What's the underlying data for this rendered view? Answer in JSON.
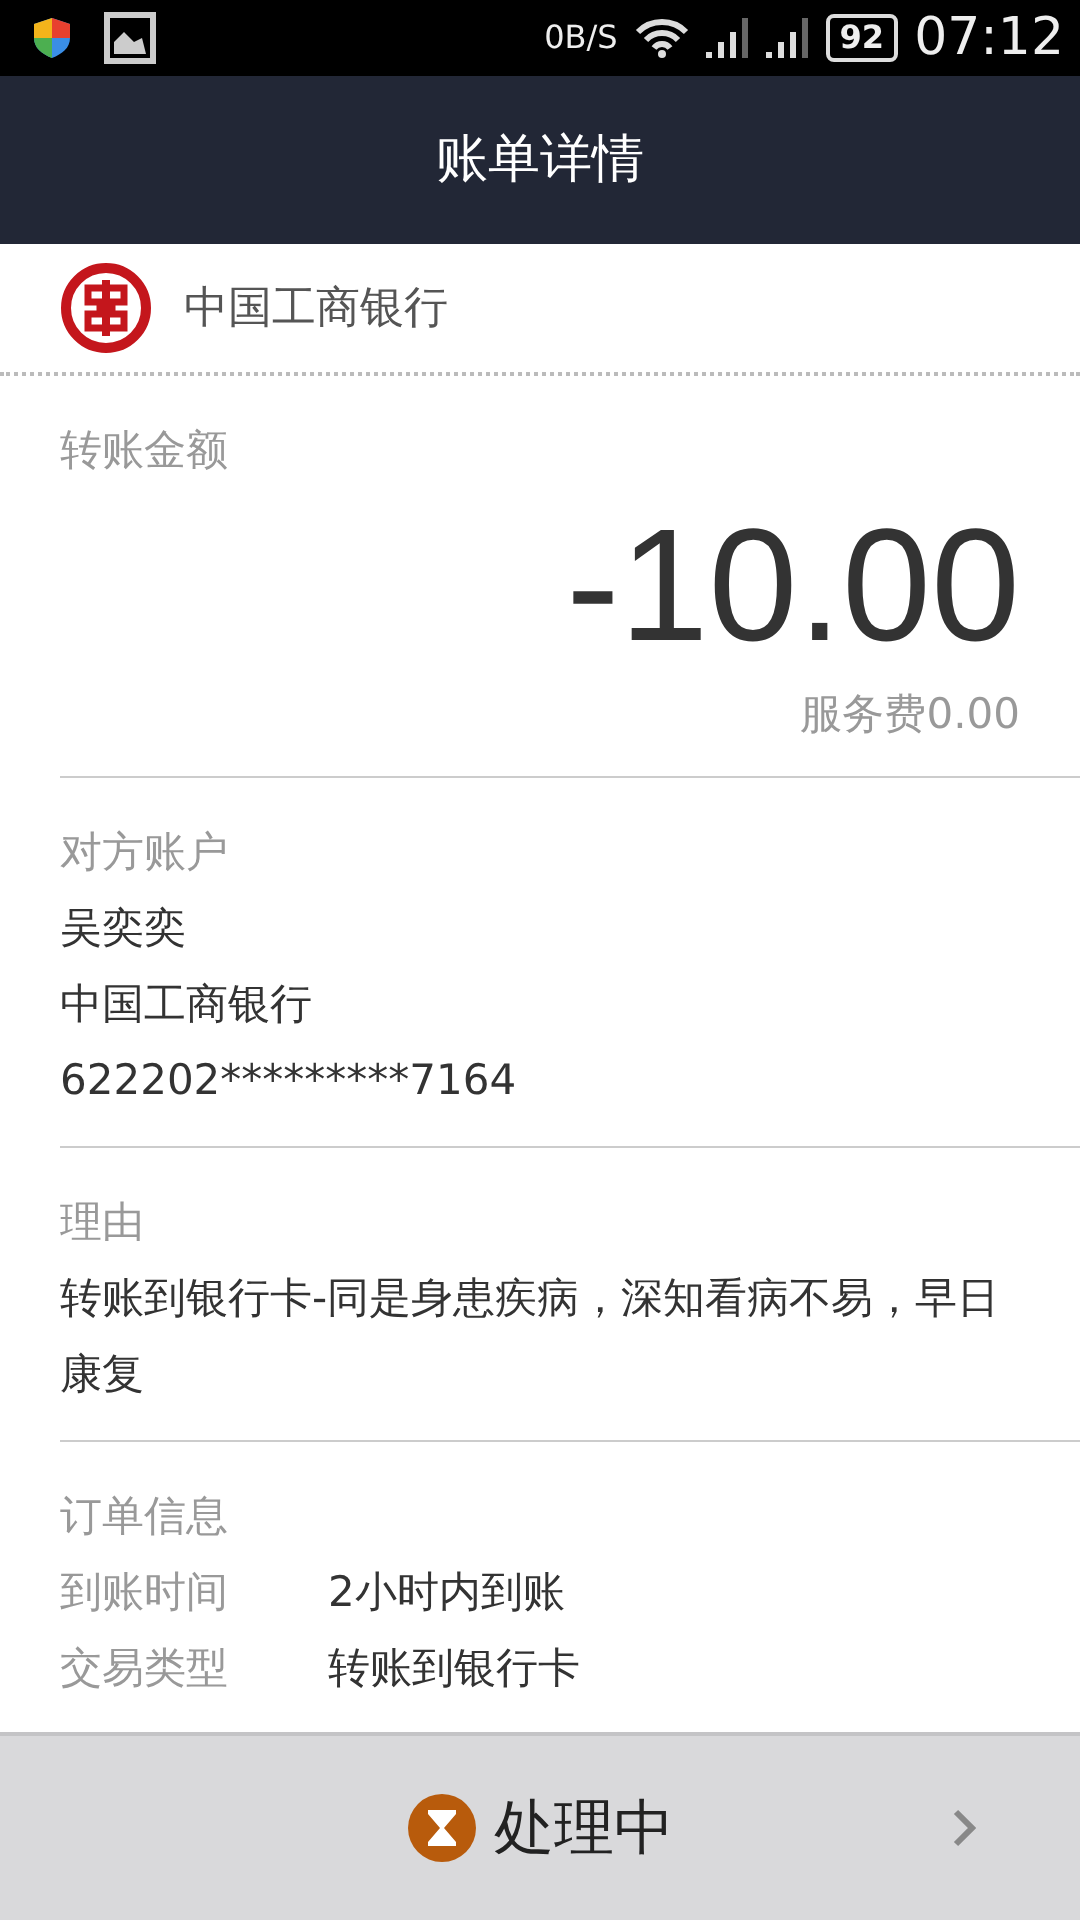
{
  "status_bar": {
    "network_speed": "0B/S",
    "battery": "92",
    "time": "07:12"
  },
  "header": {
    "title": "账单详情"
  },
  "bank": {
    "name": "中国工商银行"
  },
  "amount_section": {
    "label": "转账金额",
    "amount": "-10.00",
    "fee": "服务费0.00"
  },
  "payee": {
    "label": "对方账户",
    "lines": [
      "吴奕奕",
      "中国工商银行",
      "622202*********7164"
    ]
  },
  "reason": {
    "label": "理由",
    "text": "转账到银行卡-同是身患疾病，深知看病不易，早日康复"
  },
  "order_info": {
    "label": "订单信息",
    "rows": [
      {
        "label": "到账时间",
        "value": "2小时内到账"
      },
      {
        "label": "交易类型",
        "value": "转账到银行卡"
      }
    ]
  },
  "footer": {
    "status": "处理中"
  }
}
